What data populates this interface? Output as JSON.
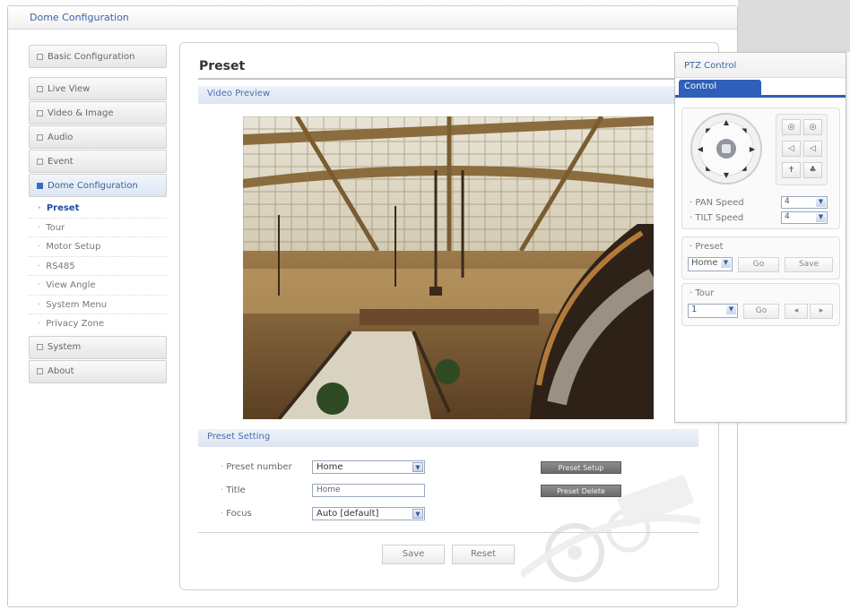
{
  "window": {
    "title": "Dome Configuration"
  },
  "sidebar": {
    "top_item": "Basic Configuration",
    "items": [
      "Live View",
      "Video & Image",
      "Audio",
      "Event"
    ],
    "active_item": "Dome Configuration",
    "sub_items": [
      "Preset",
      "Tour",
      "Motor Setup",
      "RS485",
      "View Angle",
      "System Menu",
      "Privacy Zone"
    ],
    "bottom_items": [
      "System",
      "About"
    ]
  },
  "main": {
    "title": "Preset",
    "video_section": "Video Preview",
    "setting_section": "Preset Setting",
    "preset_number_label": "Preset number",
    "preset_number_value": "Home",
    "title_label": "Title",
    "title_value": "Home",
    "focus_label": "Focus",
    "focus_value": "Auto  [default]",
    "preset_setup_btn": "Preset Setup",
    "preset_delete_btn": "Preset Delete",
    "save_btn": "Save",
    "reset_btn": "Reset"
  },
  "ptz": {
    "title": "PTZ Control",
    "tab": "Control",
    "pan_speed_label": "PAN Speed",
    "pan_speed_value": "4",
    "tilt_speed_label": "TILT Speed",
    "tilt_speed_value": "4",
    "preset_label": "Preset",
    "preset_value": "Home",
    "preset_go": "Go",
    "preset_save": "Save",
    "tour_label": "Tour",
    "tour_value": "1",
    "tour_go": "Go"
  },
  "colors": {
    "accent": "#2f5fb8",
    "link": "#3a64a8",
    "section_bg": "#e3e9f4"
  }
}
